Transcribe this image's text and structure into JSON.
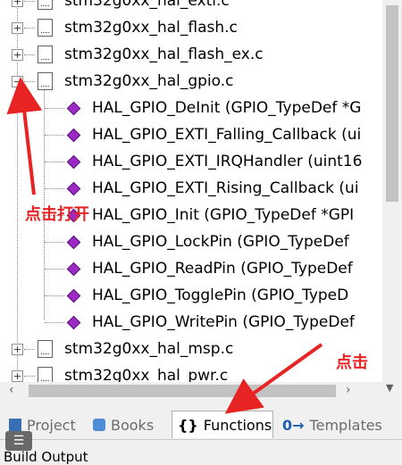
{
  "tree": {
    "items": [
      {
        "label": "stm32g0xx_hal_exti.c"
      },
      {
        "label": "stm32g0xx_hal_flash.c"
      },
      {
        "label": "stm32g0xx_hal_flash_ex.c"
      },
      {
        "label": "stm32g0xx_hal_gpio.c"
      },
      {
        "label": "HAL_GPIO_DeInit (GPIO_TypeDef *G"
      },
      {
        "label": "HAL_GPIO_EXTI_Falling_Callback (ui"
      },
      {
        "label": "HAL_GPIO_EXTI_IRQHandler (uint16"
      },
      {
        "label": "HAL_GPIO_EXTI_Rising_Callback (ui"
      },
      {
        "label": "HAL_GPIO_Init (GPIO_TypeDef *GPI"
      },
      {
        "label": "HAL_GPIO_LockPin (GPIO_TypeDef"
      },
      {
        "label": "HAL_GPIO_ReadPin (GPIO_TypeDef"
      },
      {
        "label": "HAL_GPIO_TogglePin (GPIO_TypeD"
      },
      {
        "label": "HAL_GPIO_WritePin (GPIO_TypeDef"
      },
      {
        "label": "stm32g0xx_hal_msp.c"
      },
      {
        "label": "stm32g0xx_hal_pwr.c"
      }
    ]
  },
  "tabs": [
    {
      "label": "Project",
      "icon": "project-icon"
    },
    {
      "label": "Books",
      "icon": "books-icon"
    },
    {
      "label": "Functions",
      "icon": "braces-icon"
    },
    {
      "label": "Templates",
      "icon": "templates-icon"
    }
  ],
  "bottom": {
    "label": "Build Output"
  },
  "annotations": {
    "expand_note": "点击打开",
    "click_note": "点击"
  },
  "colors": {
    "annotation": "#e82323",
    "function_icon": "#9b2bc4"
  }
}
